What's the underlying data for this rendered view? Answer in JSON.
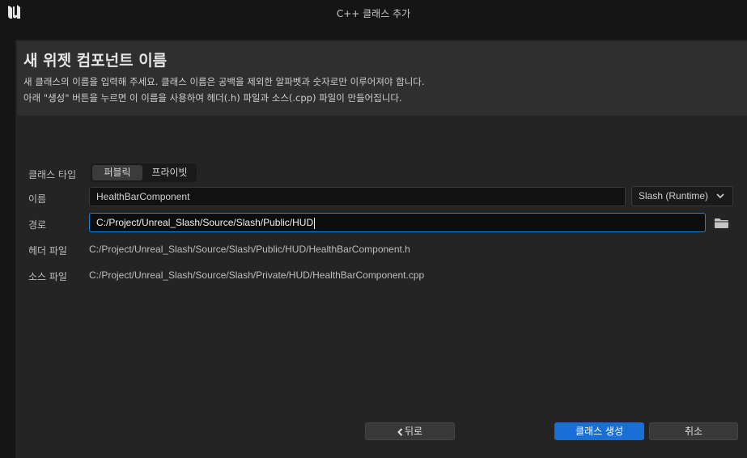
{
  "window": {
    "title": "C++ 클래스 추가"
  },
  "header": {
    "title": "새 위젯 컴포넌트 이름",
    "line1": "새 클래스의 이름을 입력해 주세요. 클래스 이름은 공백을 제외한 알파벳과 숫자로만 이루어져야 합니다.",
    "line2": "아래 \"생성\" 버튼을 누르면 이 이름을 사용하여 헤더(.h) 파일과 소스(.cpp) 파일이 만들어집니다."
  },
  "form": {
    "class_type_label": "클래스 타입",
    "class_type_options": [
      "퍼블릭",
      "프라이빗"
    ],
    "class_type_selected": "퍼블릭",
    "name_label": "이름",
    "name_value": "HealthBarComponent",
    "module_value": "Slash (Runtime)",
    "path_label": "경로",
    "path_value": "C:/Project/Unreal_Slash/Source/Slash/Public/HUD",
    "header_file_label": "헤더 파일",
    "header_file_value": "C:/Project/Unreal_Slash/Source/Slash/Public/HUD/HealthBarComponent.h",
    "source_file_label": "소스 파일",
    "source_file_value": "C:/Project/Unreal_Slash/Source/Slash/Private/HUD/HealthBarComponent.cpp"
  },
  "buttons": {
    "back": "뒤로",
    "create": "클래스 생성",
    "cancel": "취소"
  },
  "colors": {
    "accent": "#1a6fd6",
    "background": "#242424"
  }
}
